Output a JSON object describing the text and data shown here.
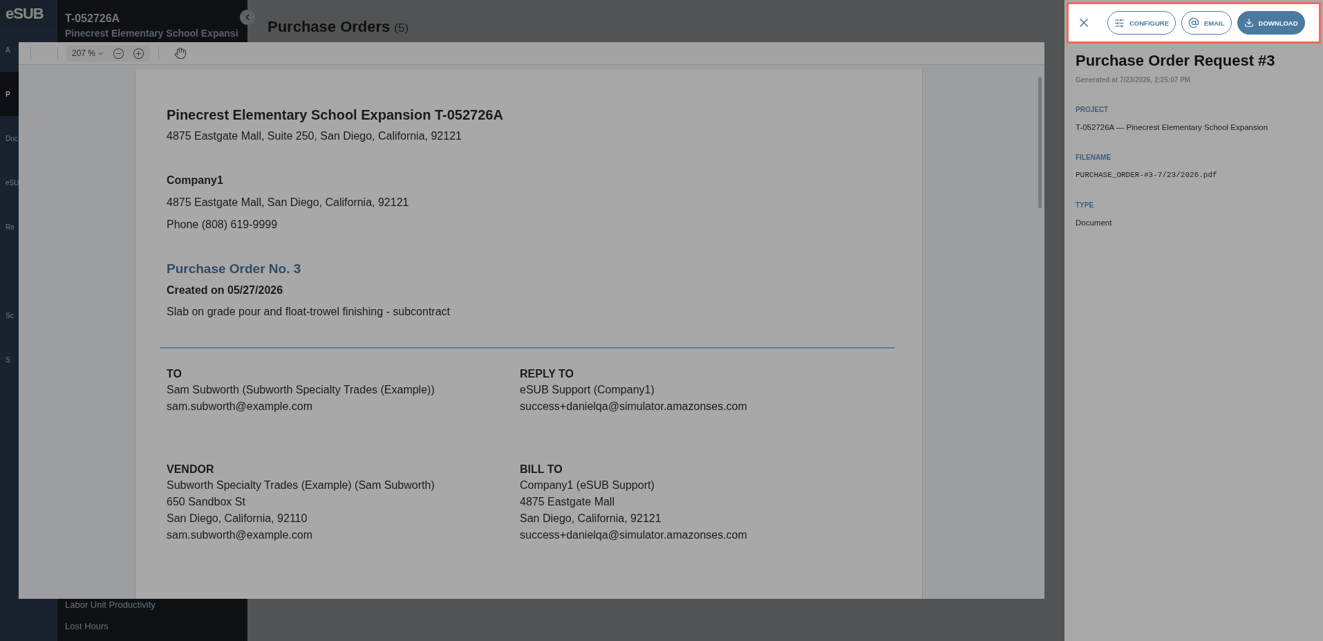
{
  "rail": {
    "logo": "eSUB",
    "items": [
      {
        "label": "A",
        "selected": false
      },
      {
        "label": "P",
        "selected": true
      },
      {
        "label": "Doc",
        "selected": false
      },
      {
        "label": "eSU",
        "selected": false
      },
      {
        "label": "Re",
        "selected": false
      },
      {
        "label": "Sc",
        "selected": false
      },
      {
        "label": "S",
        "selected": false
      }
    ]
  },
  "sidebar": {
    "project_code": "T-052726A",
    "project_name": "Pinecrest Elementary School Expansi",
    "items": [
      "Labor Unit Productivity",
      "Lost Hours"
    ]
  },
  "main": {
    "title": "Purchase Orders",
    "count": "(5)"
  },
  "viewer": {
    "zoom": "207 %",
    "document": {
      "title": "Pinecrest Elementary School Expansion T-052726A",
      "address": "4875 Eastgate Mall, Suite 250, San Diego, California, 92121",
      "company": "Company1",
      "company_lines": [
        "4875 Eastgate Mall, San Diego, California, 92121",
        "Phone (808) 619-9999"
      ],
      "order_title": "Purchase Order No. 3",
      "created": "Created on 05/27/2026",
      "description": "Slab on grade pour and float-trowel finishing - subcontract",
      "blocks": [
        {
          "heading": "TO",
          "lines": [
            "Sam Subworth (Subworth Specialty Trades (Example))",
            "sam.subworth@example.com"
          ]
        },
        {
          "heading": "REPLY TO",
          "lines": [
            "eSUB Support (Company1)",
            "success+danielqa@simulator.amazonses.com"
          ]
        },
        {
          "heading": "VENDOR",
          "lines": [
            "Subworth Specialty Trades (Example) (Sam Subworth)",
            "650 Sandbox St",
            "San Diego, California, 92110",
            "sam.subworth@example.com"
          ]
        },
        {
          "heading": "BILL TO",
          "lines": [
            "Company1 (eSUB Support)",
            "4875 Eastgate Mall",
            "San Diego, California, 92121",
            "success+danielqa@simulator.amazonses.com"
          ]
        }
      ]
    }
  },
  "panel": {
    "actions": [
      {
        "kind": "close"
      },
      {
        "kind": "configure",
        "label": "CONFIGURE"
      },
      {
        "kind": "email",
        "label": "EMAIL"
      },
      {
        "kind": "download",
        "label": "DOWNLOAD"
      }
    ],
    "title": "Purchase Order Request #3",
    "generated": "Generated at 7/23/2026, 2:25:07 PM",
    "fields": [
      {
        "label": "PROJECT",
        "value": "T-052726A — Pinecrest Elementary School Expansion",
        "kind": "text"
      },
      {
        "label": "FILENAME",
        "value": "PURCHASE_ORDER-#3-7/23/2026.pdf",
        "kind": "mono"
      },
      {
        "label": "TYPE",
        "value": "Document",
        "kind": "text"
      }
    ]
  }
}
